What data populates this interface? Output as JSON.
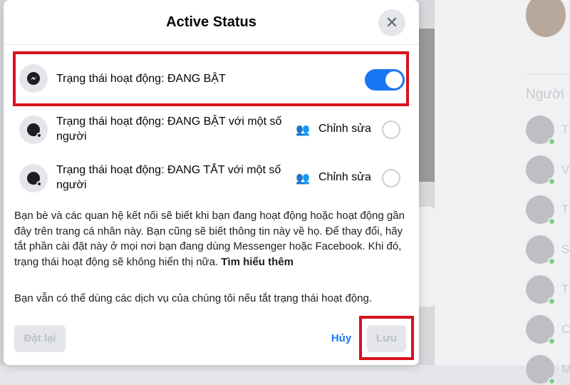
{
  "background": {
    "people_heading": "Người",
    "contact_initials": [
      "T",
      "V",
      "T",
      "S",
      "T",
      "C",
      "M"
    ]
  },
  "modal": {
    "title": "Active Status",
    "close_label": "✕",
    "main_toggle": {
      "label": "Trạng thái hoạt động: ĐANG BẬT",
      "on": true
    },
    "options": [
      {
        "label": "Trạng thái hoạt động: ĐANG BẬT với một số người",
        "edit": "Chỉnh sửa",
        "selected": false
      },
      {
        "label": "Trạng thái hoạt động: ĐANG TẮT với một số người",
        "edit": "Chỉnh sửa",
        "selected": false
      }
    ],
    "description": "Bạn bè và các quan hệ kết nối sẽ biết khi bạn đang hoạt động hoặc hoạt động gần đây trên trang cá nhân này. Bạn cũng sẽ biết thông tin này về họ. Để thay đổi, hãy tắt phần cài đặt này ở mọi nơi bạn đang dùng Messenger hoặc Facebook. Khi đó, trạng thái hoạt động sẽ không hiển thị nữa.",
    "learn_more": "Tìm hiểu thêm",
    "note": "Bạn vẫn có thể dùng các dịch vụ của chúng tôi nếu tắt trạng thái hoạt động.",
    "reset_label": "Đặt lại",
    "cancel_label": "Hủy",
    "save_label": "Lưu"
  },
  "colors": {
    "accent": "#1877f2",
    "highlight": "#d9121c"
  }
}
